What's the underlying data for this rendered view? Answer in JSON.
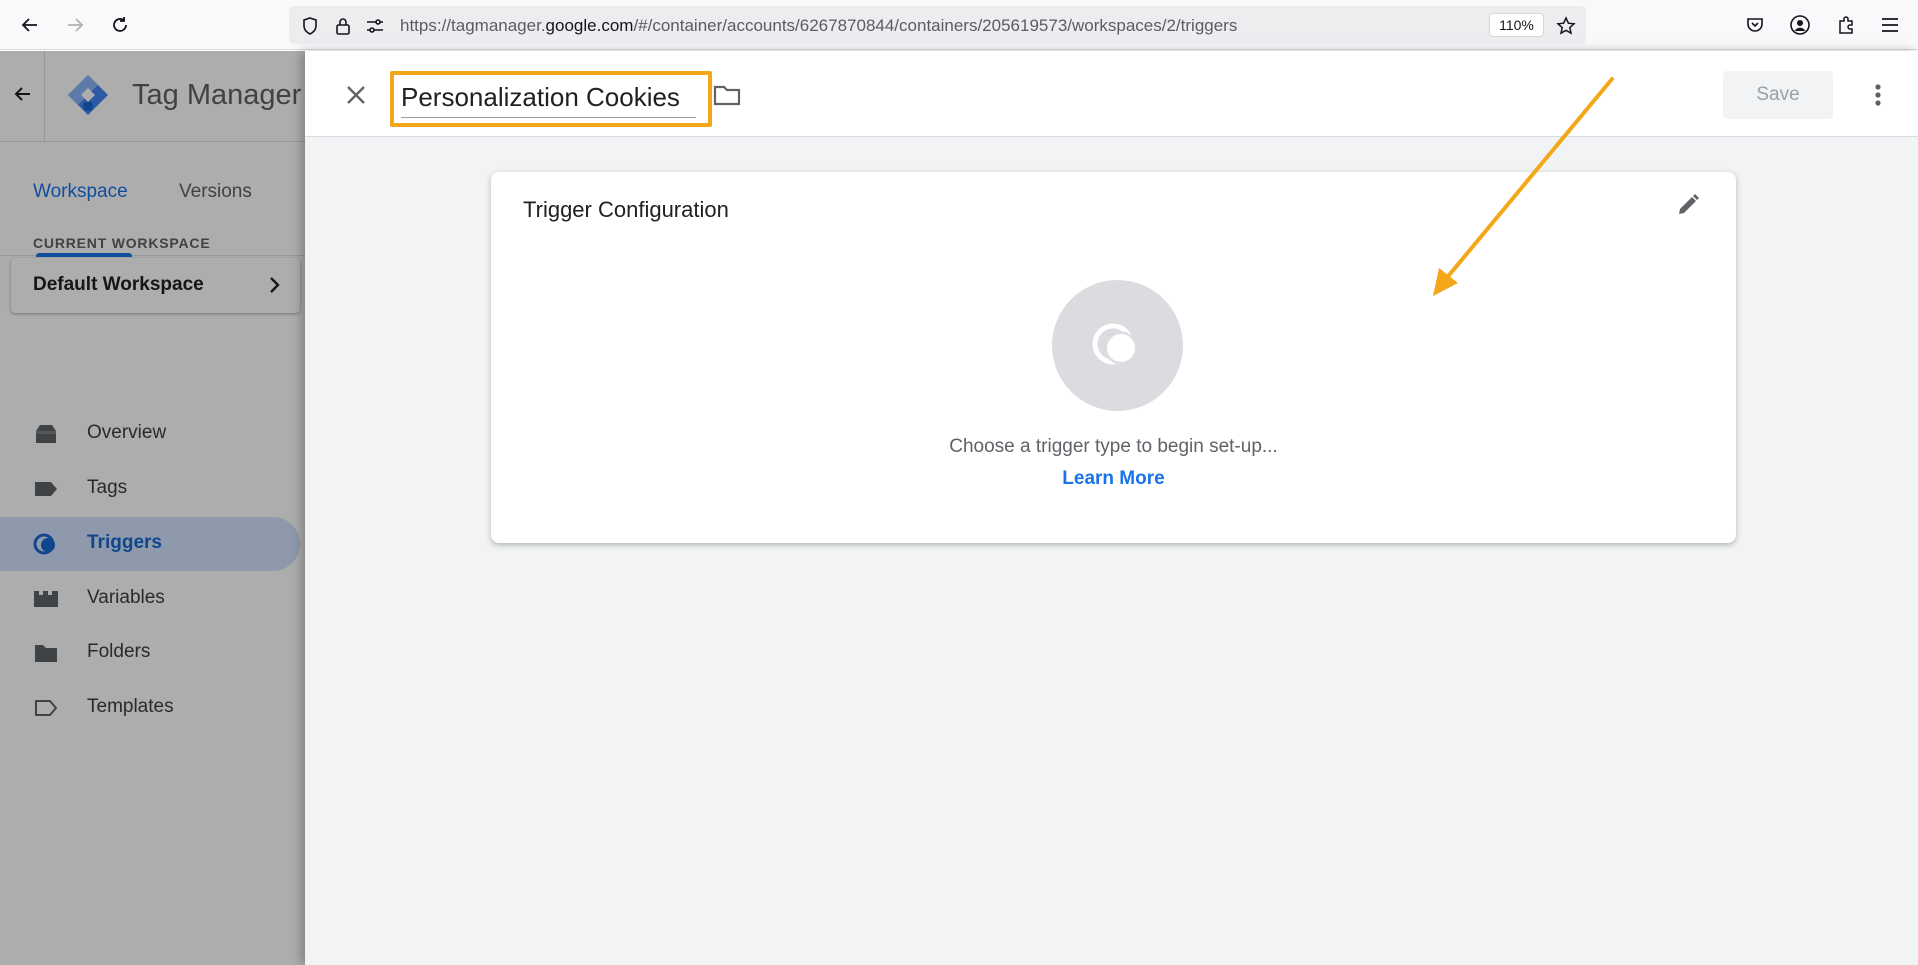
{
  "browser": {
    "url_prefix": "https://tagmanager.",
    "url_host": "google.com",
    "url_suffix": "/#/container/accounts/6267870844/containers/205619573/workspaces/2/triggers",
    "zoom": "110%"
  },
  "app": {
    "title": "Tag Manager",
    "tabs": [
      {
        "label": "Workspace",
        "active": true
      },
      {
        "label": "Versions",
        "active": false
      }
    ],
    "current_workspace_label": "CURRENT WORKSPACE",
    "workspace_name": "Default Workspace",
    "nav": [
      {
        "label": "Overview",
        "icon": "overview-icon"
      },
      {
        "label": "Tags",
        "icon": "tag-icon"
      },
      {
        "label": "Triggers",
        "icon": "trigger-icon",
        "active": true
      },
      {
        "label": "Variables",
        "icon": "variables-icon"
      },
      {
        "label": "Folders",
        "icon": "folder-icon"
      },
      {
        "label": "Templates",
        "icon": "templates-icon"
      }
    ]
  },
  "editor": {
    "trigger_name": "Personalization Cookies",
    "save_label": "Save",
    "card_title": "Trigger Configuration",
    "empty_text": "Choose a trigger type to begin set-up...",
    "learn_more": "Learn More"
  },
  "colors": {
    "accent": "#1a73e8",
    "highlight": "#f5a71a",
    "annotation_arrow": "#f5a71a"
  }
}
